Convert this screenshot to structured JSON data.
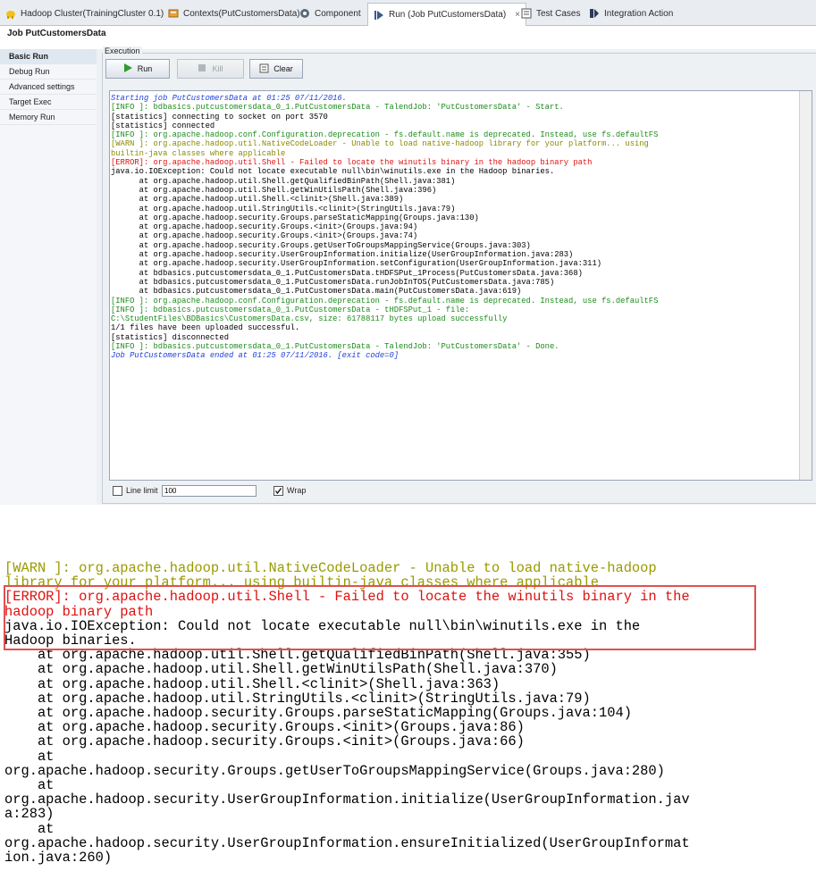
{
  "tabs": [
    {
      "label": "Hadoop Cluster(TrainingCluster 0.1)",
      "icon": "hadoop-elephant-icon"
    },
    {
      "label": "Contexts(PutCustomersData)",
      "icon": "contexts-icon"
    },
    {
      "label": "Component",
      "icon": "component-icon"
    },
    {
      "label": "Run (Job PutCustomersData)",
      "icon": "run-icon",
      "active": true
    },
    {
      "label": "Test Cases",
      "icon": "test-cases-icon"
    },
    {
      "label": "Integration Action",
      "icon": "integration-icon"
    }
  ],
  "close_glyph": "×",
  "job_title": "Job PutCustomersData",
  "nav": [
    {
      "label": "Basic Run",
      "selected": true
    },
    {
      "label": "Debug Run"
    },
    {
      "label": "Advanced settings"
    },
    {
      "label": "Target Exec"
    },
    {
      "label": "Memory Run"
    }
  ],
  "execution": {
    "legend": "Execution",
    "run": "Run",
    "kill": "Kill",
    "clear": "Clear"
  },
  "console_lines": [
    {
      "text": "Starting job PutCustomersData at 01:25 07/11/2016.",
      "color": "blue"
    },
    {
      "text": "",
      "color": "black"
    },
    {
      "text": "[INFO ]: bdbasics.putcustomersdata_0_1.PutCustomersData - TalendJob: 'PutCustomersData' - Start.",
      "color": "green"
    },
    {
      "text": "[statistics] connecting to socket on port 3570",
      "color": "black"
    },
    {
      "text": "[statistics] connected",
      "color": "black"
    },
    {
      "text": "[INFO ]: org.apache.hadoop.conf.Configuration.deprecation - fs.default.name is deprecated. Instead, use fs.defaultFS",
      "color": "green"
    },
    {
      "text": "[WARN ]: org.apache.hadoop.util.NativeCodeLoader - Unable to load native-hadoop library for your platform... using",
      "color": "olive"
    },
    {
      "text": "builtin-java classes where applicable",
      "color": "olive"
    },
    {
      "text": "[ERROR]: org.apache.hadoop.util.Shell - Failed to locate the winutils binary in the hadoop binary path",
      "color": "red"
    },
    {
      "text": "java.io.IOException: Could not locate executable null\\bin\\winutils.exe in the Hadoop binaries.",
      "color": "black"
    },
    {
      "text": "      at org.apache.hadoop.util.Shell.getQualifiedBinPath(Shell.java:381)",
      "color": "black"
    },
    {
      "text": "      at org.apache.hadoop.util.Shell.getWinUtilsPath(Shell.java:396)",
      "color": "black"
    },
    {
      "text": "      at org.apache.hadoop.util.Shell.<clinit>(Shell.java:389)",
      "color": "black"
    },
    {
      "text": "      at org.apache.hadoop.util.StringUtils.<clinit>(StringUtils.java:79)",
      "color": "black"
    },
    {
      "text": "      at org.apache.hadoop.security.Groups.parseStaticMapping(Groups.java:130)",
      "color": "black"
    },
    {
      "text": "      at org.apache.hadoop.security.Groups.<init>(Groups.java:94)",
      "color": "black"
    },
    {
      "text": "      at org.apache.hadoop.security.Groups.<init>(Groups.java:74)",
      "color": "black"
    },
    {
      "text": "      at org.apache.hadoop.security.Groups.getUserToGroupsMappingService(Groups.java:303)",
      "color": "black"
    },
    {
      "text": "      at org.apache.hadoop.security.UserGroupInformation.initialize(UserGroupInformation.java:283)",
      "color": "black"
    },
    {
      "text": "      at org.apache.hadoop.security.UserGroupInformation.setConfiguration(UserGroupInformation.java:311)",
      "color": "black"
    },
    {
      "text": "      at bdbasics.putcustomersdata_0_1.PutCustomersData.tHDFSPut_1Process(PutCustomersData.java:368)",
      "color": "black"
    },
    {
      "text": "      at bdbasics.putcustomersdata_0_1.PutCustomersData.runJobInTOS(PutCustomersData.java:785)",
      "color": "black"
    },
    {
      "text": "      at bdbasics.putcustomersdata_0_1.PutCustomersData.main(PutCustomersData.java:619)",
      "color": "black"
    },
    {
      "text": "[INFO ]: org.apache.hadoop.conf.Configuration.deprecation - fs.default.name is deprecated. Instead, use fs.defaultFS",
      "color": "green"
    },
    {
      "text": "[INFO ]: bdbasics.putcustomersdata_0_1.PutCustomersData - tHDFSPut_1 - file:",
      "color": "green"
    },
    {
      "text": "C:\\StudentFiles\\BDBasics\\CustomersData.csv, size: 61788117 bytes upload successfully",
      "color": "green"
    },
    {
      "text": "1/1 files have been uploaded successful.",
      "color": "black"
    },
    {
      "text": "",
      "color": "black"
    },
    {
      "text": "[statistics] disconnected",
      "color": "black"
    },
    {
      "text": "[INFO ]: bdbasics.putcustomersdata_0_1.PutCustomersData - TalendJob: 'PutCustomersData' - Done.",
      "color": "green"
    },
    {
      "text": "Job PutCustomersData ended at 01:25 07/11/2016. [exit code=0]",
      "color": "blue"
    }
  ],
  "bottom": {
    "line_limit_label": "Line limit",
    "line_limit_value": "100",
    "line_limit_checked": false,
    "wrap_label": "Wrap",
    "wrap_checked": true
  },
  "zoom_lines": [
    {
      "text": "[WARN ]: org.apache.hadoop.util.NativeCodeLoader - Unable to load native-hadoop",
      "color": "olive"
    },
    {
      "text": "library for your platform... using builtin-java classes where applicable",
      "color": "olive"
    },
    {
      "text": "[ERROR]: org.apache.hadoop.util.Shell - Failed to locate the winutils binary in the",
      "color": "red"
    },
    {
      "text": "hadoop binary path",
      "color": "red"
    },
    {
      "text": "java.io.IOException: Could not locate executable null\\bin\\winutils.exe in the",
      "color": "black"
    },
    {
      "text": "Hadoop binaries.",
      "color": "black"
    },
    {
      "text": "    at org.apache.hadoop.util.Shell.getQualifiedBinPath(Shell.java:355)",
      "color": "black"
    },
    {
      "text": "    at org.apache.hadoop.util.Shell.getWinUtilsPath(Shell.java:370)",
      "color": "black"
    },
    {
      "text": "    at org.apache.hadoop.util.Shell.<clinit>(Shell.java:363)",
      "color": "black"
    },
    {
      "text": "    at org.apache.hadoop.util.StringUtils.<clinit>(StringUtils.java:79)",
      "color": "black"
    },
    {
      "text": "    at org.apache.hadoop.security.Groups.parseStaticMapping(Groups.java:104)",
      "color": "black"
    },
    {
      "text": "    at org.apache.hadoop.security.Groups.<init>(Groups.java:86)",
      "color": "black"
    },
    {
      "text": "    at org.apache.hadoop.security.Groups.<init>(Groups.java:66)",
      "color": "black"
    },
    {
      "text": "    at",
      "color": "black"
    },
    {
      "text": "org.apache.hadoop.security.Groups.getUserToGroupsMappingService(Groups.java:280)",
      "color": "black"
    },
    {
      "text": "    at",
      "color": "black"
    },
    {
      "text": "org.apache.hadoop.security.UserGroupInformation.initialize(UserGroupInformation.jav",
      "color": "black"
    },
    {
      "text": "a:283)",
      "color": "black"
    },
    {
      "text": "    at",
      "color": "black"
    },
    {
      "text": "org.apache.hadoop.security.UserGroupInformation.ensureInitialized(UserGroupInformat",
      "color": "black"
    },
    {
      "text": "ion.java:260)",
      "color": "black"
    }
  ],
  "colors": {
    "blue": "#1f3fd6",
    "green": "#1d8b1d",
    "olive": "#8a8a00",
    "red": "#e01010",
    "highlight_box": "#e05050"
  }
}
